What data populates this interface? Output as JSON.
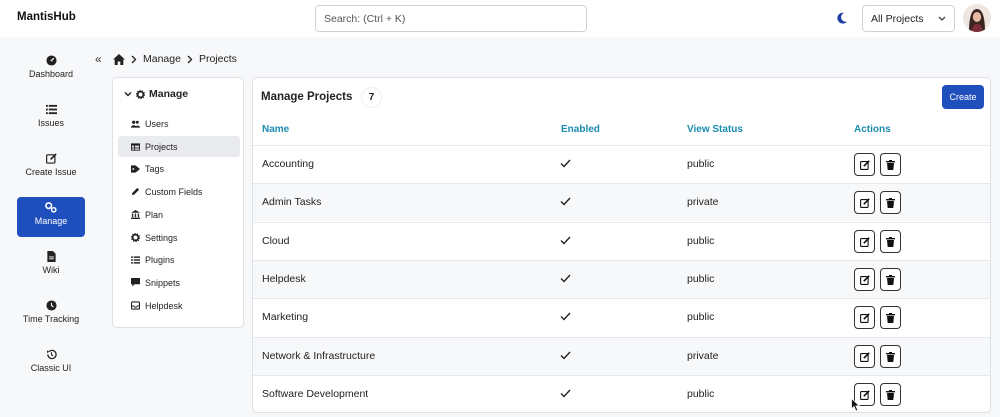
{
  "app": {
    "title": "MantisHub"
  },
  "search": {
    "placeholder": "Search: (Ctrl + K)"
  },
  "project_selector": {
    "selected": "All Projects"
  },
  "nav": {
    "items": [
      {
        "label": "Dashboard",
        "icon": "dashboard-icon"
      },
      {
        "label": "Issues",
        "icon": "list-icon"
      },
      {
        "label": "Create Issue",
        "icon": "edit-icon"
      },
      {
        "label": "Manage",
        "icon": "gears-icon",
        "active": true
      },
      {
        "label": "Wiki",
        "icon": "file-icon"
      },
      {
        "label": "Time Tracking",
        "icon": "clock-icon"
      },
      {
        "label": "Classic UI",
        "icon": "history-icon"
      }
    ]
  },
  "breadcrumb": {
    "items": [
      "Manage",
      "Projects"
    ]
  },
  "submenu": {
    "title": "Manage",
    "items": [
      {
        "label": "Users",
        "icon": "users-icon"
      },
      {
        "label": "Projects",
        "icon": "table-icon",
        "active": true
      },
      {
        "label": "Tags",
        "icon": "tag-icon"
      },
      {
        "label": "Custom Fields",
        "icon": "pencil-icon"
      },
      {
        "label": "Plan",
        "icon": "bank-icon"
      },
      {
        "label": "Settings",
        "icon": "gear-icon"
      },
      {
        "label": "Plugins",
        "icon": "list-icon"
      },
      {
        "label": "Snippets",
        "icon": "comment-icon"
      },
      {
        "label": "Helpdesk",
        "icon": "inbox-icon"
      }
    ]
  },
  "main": {
    "title": "Manage Projects",
    "count": "7",
    "create_label": "Create",
    "columns": [
      "Name",
      "Enabled",
      "View Status",
      "Actions"
    ],
    "rows": [
      {
        "name": "Accounting",
        "enabled": true,
        "view_status": "public"
      },
      {
        "name": "Admin Tasks",
        "enabled": true,
        "view_status": "private"
      },
      {
        "name": "Cloud",
        "enabled": true,
        "view_status": "public"
      },
      {
        "name": "Helpdesk",
        "enabled": true,
        "view_status": "public"
      },
      {
        "name": "Marketing",
        "enabled": true,
        "view_status": "public"
      },
      {
        "name": "Network & Infrastructure",
        "enabled": true,
        "view_status": "private"
      },
      {
        "name": "Software Development",
        "enabled": true,
        "view_status": "public"
      }
    ]
  },
  "colors": {
    "accent": "#1f4fbd",
    "header_text": "#1a8cb0"
  }
}
